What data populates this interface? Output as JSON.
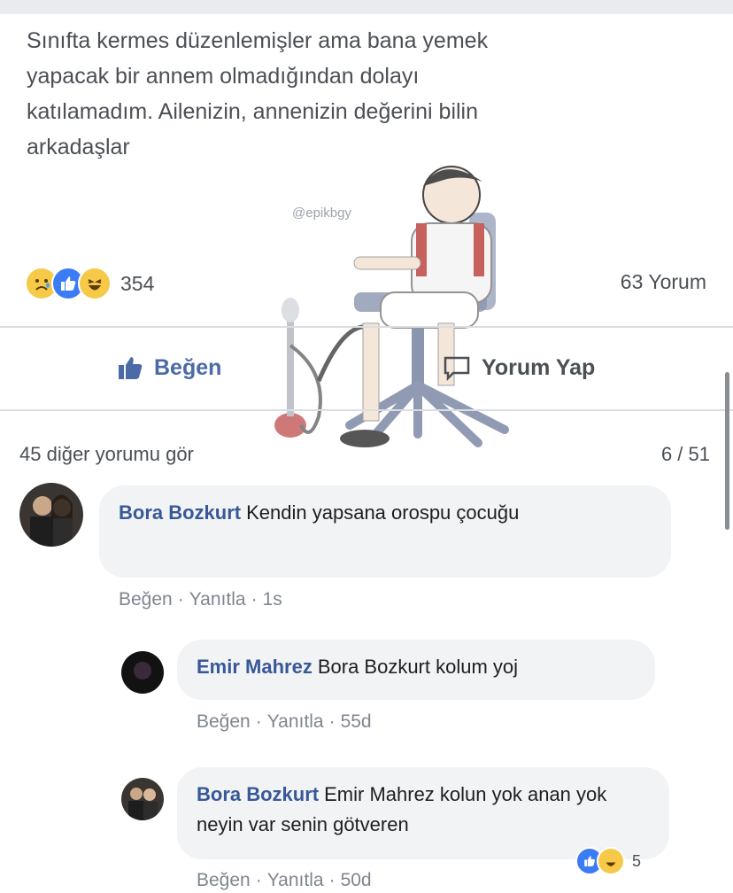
{
  "post": {
    "text": "Sınıfta kermes düzenlemişler ama bana yemek\nyapacak bir annem olmadığından dolayı\nkatılamadım. Ailenizin, annenizin değerini bilin\narkadaşlar",
    "watermark": "@epikbgy",
    "reaction_count": "354",
    "comment_count": "63 Yorum",
    "reactions": [
      "sad-icon",
      "like-icon",
      "haha-icon"
    ]
  },
  "actions": {
    "like_label": "Beğen",
    "comment_label": "Yorum Yap"
  },
  "comments_bar": {
    "more_label": "45 diğer yorumu gör",
    "pager": "6 / 51"
  },
  "comments": [
    {
      "author": "Bora Bozkurt",
      "text": "Kendin yapsana orospu çocuğu",
      "like": "Beğen",
      "reply": "Yanıtla",
      "time": "1s"
    },
    {
      "author": "Emir Mahrez",
      "text": "Bora Bozkurt kolum yoj",
      "like": "Beğen",
      "reply": "Yanıtla",
      "time": "55d"
    },
    {
      "author": "Bora Bozkurt",
      "text": "Emir Mahrez kolun yok anan yok neyin var senin götveren",
      "like": "Beğen",
      "reply": "Yanıtla",
      "time": "50d",
      "reaction_count": "5"
    }
  ],
  "colors": {
    "link_blue": "#385898",
    "like_blue": "#4b6aa8",
    "bubble_gray": "#f2f3f5",
    "meta_gray": "#7f8591"
  }
}
